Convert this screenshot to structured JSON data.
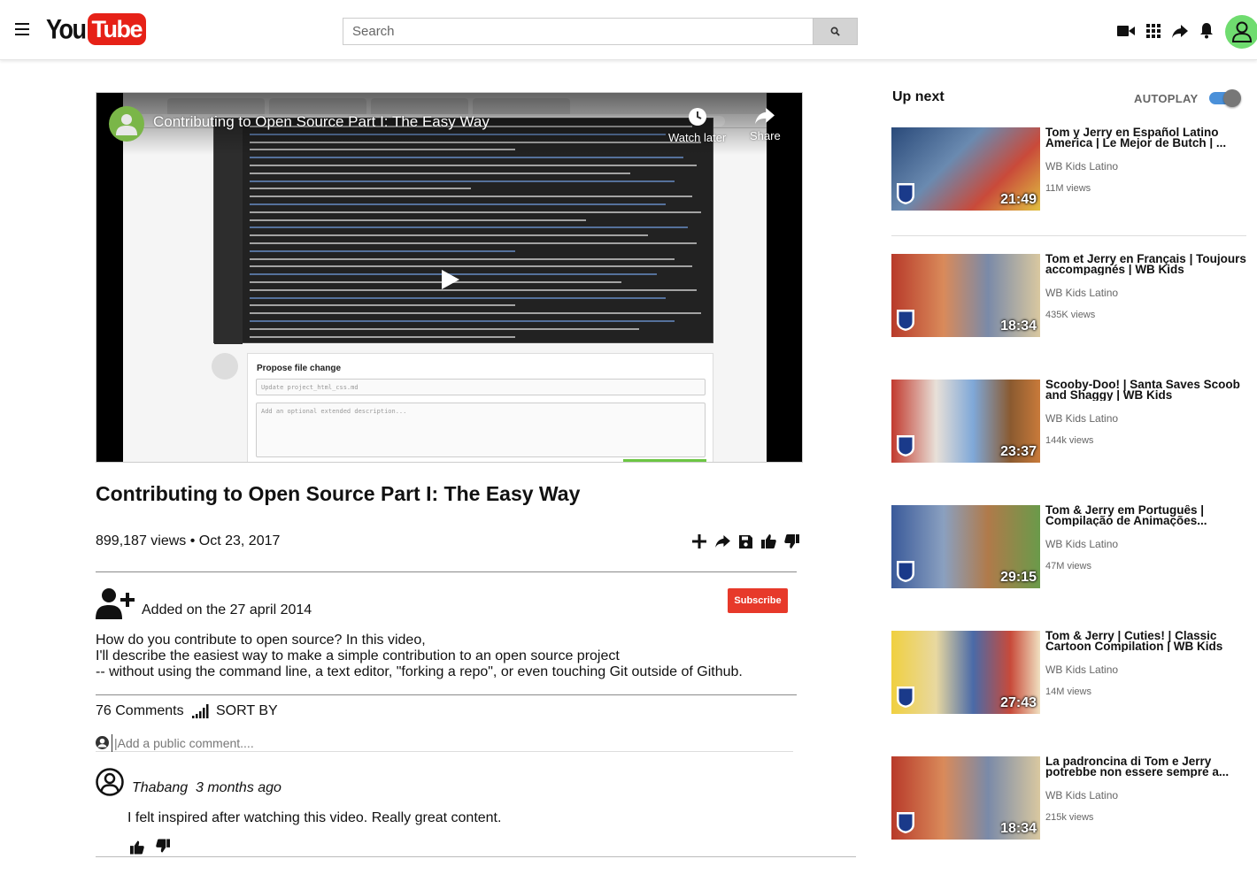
{
  "header": {
    "logo_you": "You",
    "logo_tube": "Tube",
    "search_placeholder": "Search",
    "icons": [
      "menu-icon",
      "search-icon",
      "video-camera-icon",
      "apps-grid-icon",
      "share-icon",
      "bell-icon",
      "account-icon"
    ]
  },
  "player": {
    "overlay_title": "Contributing to Open Source Part I: The Easy Way",
    "watch_later": "Watch later",
    "share": "Share",
    "propose_title": "Propose file change",
    "propose_placeholder": "Update project_html_css.md",
    "propose_desc_placeholder": "Add an optional extended description..."
  },
  "video": {
    "title": "Contributing to Open Source Part I: The Easy Way",
    "views_date": "899,187 views • Oct 23, 2017",
    "added_on": "Added on the 27 april 2014",
    "subscribe": "Subscribe",
    "description": [
      "How do you contribute to open source? In this video,",
      "I'll describe the easiest way to make a simple contribution to an open source project",
      "-- without using the command line, a text editor, \"forking a repo\", or even touching Git outside of Github."
    ]
  },
  "comments": {
    "count": "76 Comments",
    "sort_by": "SORT BY",
    "input_placeholder": "|Add a public comment....",
    "items": [
      {
        "author": "Thabang",
        "time": "3 months ago",
        "text": "I felt inspired after watching this video. Really great content."
      }
    ]
  },
  "sidebar": {
    "up_next": "Up next",
    "autoplay": "AUTOPLAY",
    "autoplay_on": true,
    "items": [
      {
        "title": "Tom y Jerry en Español Latino America | Le Mejor de Butch | ...",
        "channel": "WB Kids Latino",
        "views": "11M views",
        "duration": "21:49"
      },
      {
        "title": "Tom et Jerry en Français | Toujours accompagnés | WB Kids",
        "channel": "WB Kids Latino",
        "views": "435K views",
        "duration": "18:34"
      },
      {
        "title": "Scooby-Doo! | Santa Saves Scoob and Shaggy | WB Kids",
        "channel": "WB Kids Latino",
        "views": "144k views",
        "duration": "23:37"
      },
      {
        "title": "Tom & Jerry em Português | Compilação de Animações...",
        "channel": "WB Kids Latino",
        "views": "47M views",
        "duration": "29:15"
      },
      {
        "title": "Tom & Jerry | Cuties! | Classic Cartoon Compilation | WB Kids",
        "channel": "WB Kids Latino",
        "views": "14M views",
        "duration": "27:43"
      },
      {
        "title": "La padroncina di Tom e Jerry potrebbe non essere sempre a...",
        "channel": "WB Kids Latino",
        "views": "215k views",
        "duration": "18:34"
      }
    ]
  }
}
